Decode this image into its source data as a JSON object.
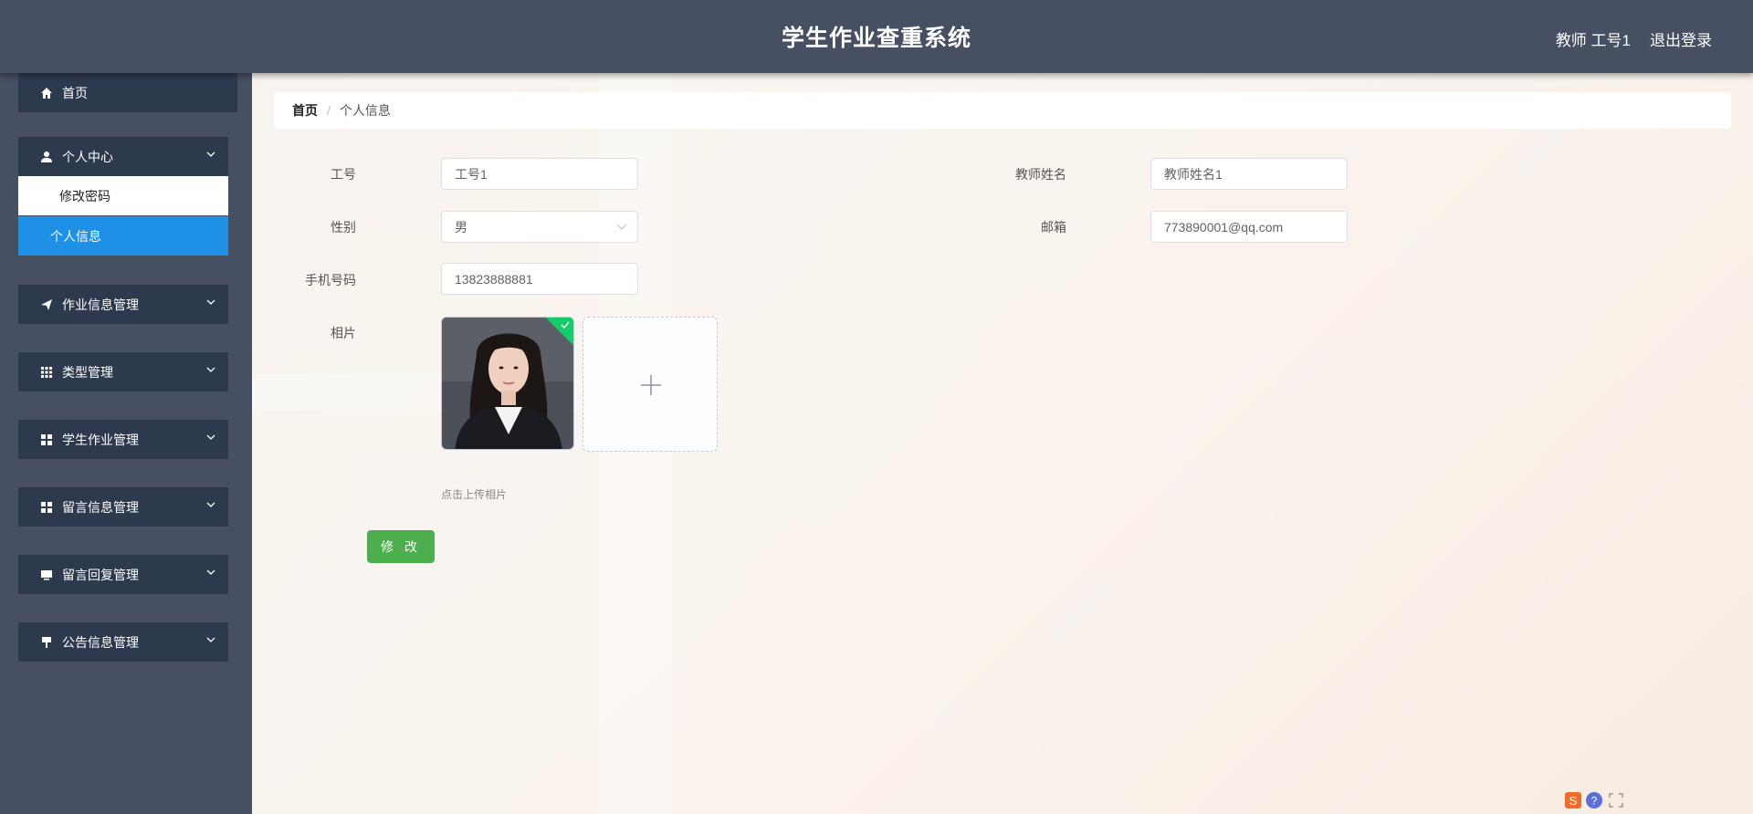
{
  "header": {
    "title": "学生作业查重系统",
    "user": "教师 工号1",
    "logout": "退出登录"
  },
  "sidebar": {
    "home": "首页",
    "personal_center": "个人中心",
    "change_password": "修改密码",
    "personal_info": "个人信息",
    "menus": [
      "作业信息管理",
      "类型管理",
      "学生作业管理",
      "留言信息管理",
      "留言回复管理",
      "公告信息管理"
    ]
  },
  "breadcrumb": {
    "home": "首页",
    "separator": "/",
    "current": "个人信息"
  },
  "form": {
    "employee_id_label": "工号",
    "employee_id_value": "工号1",
    "teacher_name_label": "教师姓名",
    "teacher_name_value": "教师姓名1",
    "gender_label": "性别",
    "gender_value": "男",
    "email_label": "邮箱",
    "email_value": "773890001@qq.com",
    "phone_label": "手机号码",
    "phone_value": "13823888881",
    "photo_label": "相片",
    "upload_hint": "点击上传相片",
    "submit_label": "修 改"
  },
  "colors": {
    "header_bg": "#474f63",
    "menu_bg": "#2d3a4d",
    "active_menu": "#1e90e6",
    "submit_btn": "#4cae4c",
    "upload_success": "#13ce66"
  }
}
